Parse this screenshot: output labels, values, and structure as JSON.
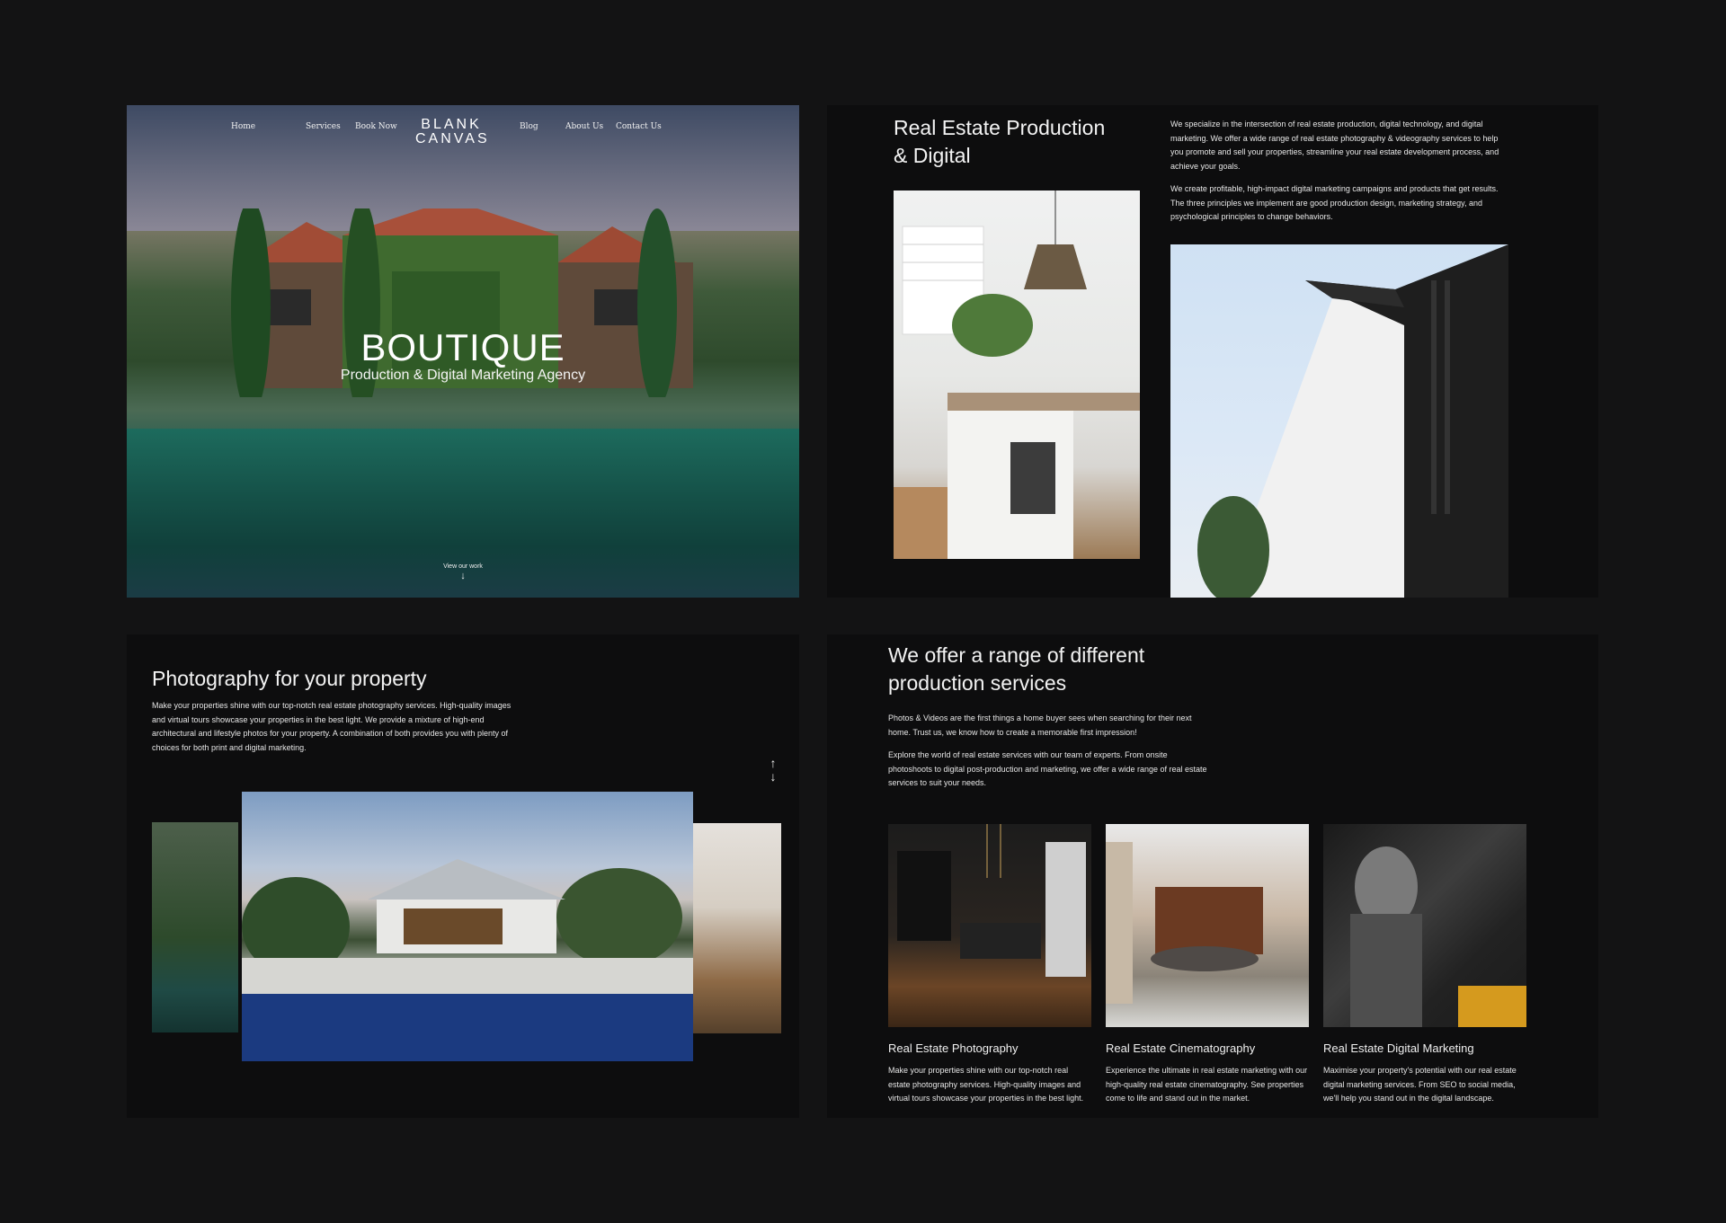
{
  "hero": {
    "nav": {
      "home": "Home",
      "services": "Services",
      "book_now": "Book Now",
      "blog": "Blog",
      "about_us": "About Us",
      "contact_us": "Contact Us"
    },
    "logo_line1": "BLANK",
    "logo_line2": "CANVAS",
    "title": "BOUTIQUE",
    "subtitle": "Production & Digital Marketing Agency",
    "cta": "View our work",
    "cta_icon": "arrow-down-icon"
  },
  "intro": {
    "title": "Real Estate Production & Digital",
    "para1": "We specialize in the intersection of real estate production, digital technology, and digital marketing. We offer a wide range of real estate photography & videography services to help you promote and sell your properties, streamline your real estate development process, and achieve your goals.",
    "para2": "We create profitable, high-impact digital marketing campaigns and products that get results. The three principles we implement are good production design, marketing strategy, and psychological principles to change behaviors."
  },
  "photography": {
    "title": "Photography for your property",
    "text": "Make your properties shine with our top-notch real estate photography services. High-quality images and virtual tours showcase your properties in the best light. We provide a mixture of high-end architectural and lifestyle photos for your property. A combination of both provides you with plenty of choices for both print and digital marketing.",
    "up_arrow": "↑",
    "down_arrow": "↓"
  },
  "services": {
    "title": "We offer a range of different production services",
    "para1": "Photos & Videos are the first things a home buyer sees when searching for their next home. Trust us, we know how to create a memorable first impression!",
    "para2": "Explore the world of real estate services with our team of experts. From onsite photoshoots to digital post-production and marketing, we offer a wide range of real estate services to suit your needs.",
    "cards": [
      {
        "title": "Real Estate Photography",
        "text": "Make your properties shine with our top-notch real estate photography services. High-quality images and virtual tours showcase your properties in the best light."
      },
      {
        "title": "Real Estate Cinematography",
        "text": "Experience the ultimate in real estate marketing with our high-quality real estate cinematography.  See properties come to life and stand out in the market."
      },
      {
        "title": "Real Estate Digital Marketing",
        "text": "Maximise your property's potential with our real estate digital marketing services. From SEO to social media, we'll help you stand out in the digital landscape."
      }
    ]
  }
}
